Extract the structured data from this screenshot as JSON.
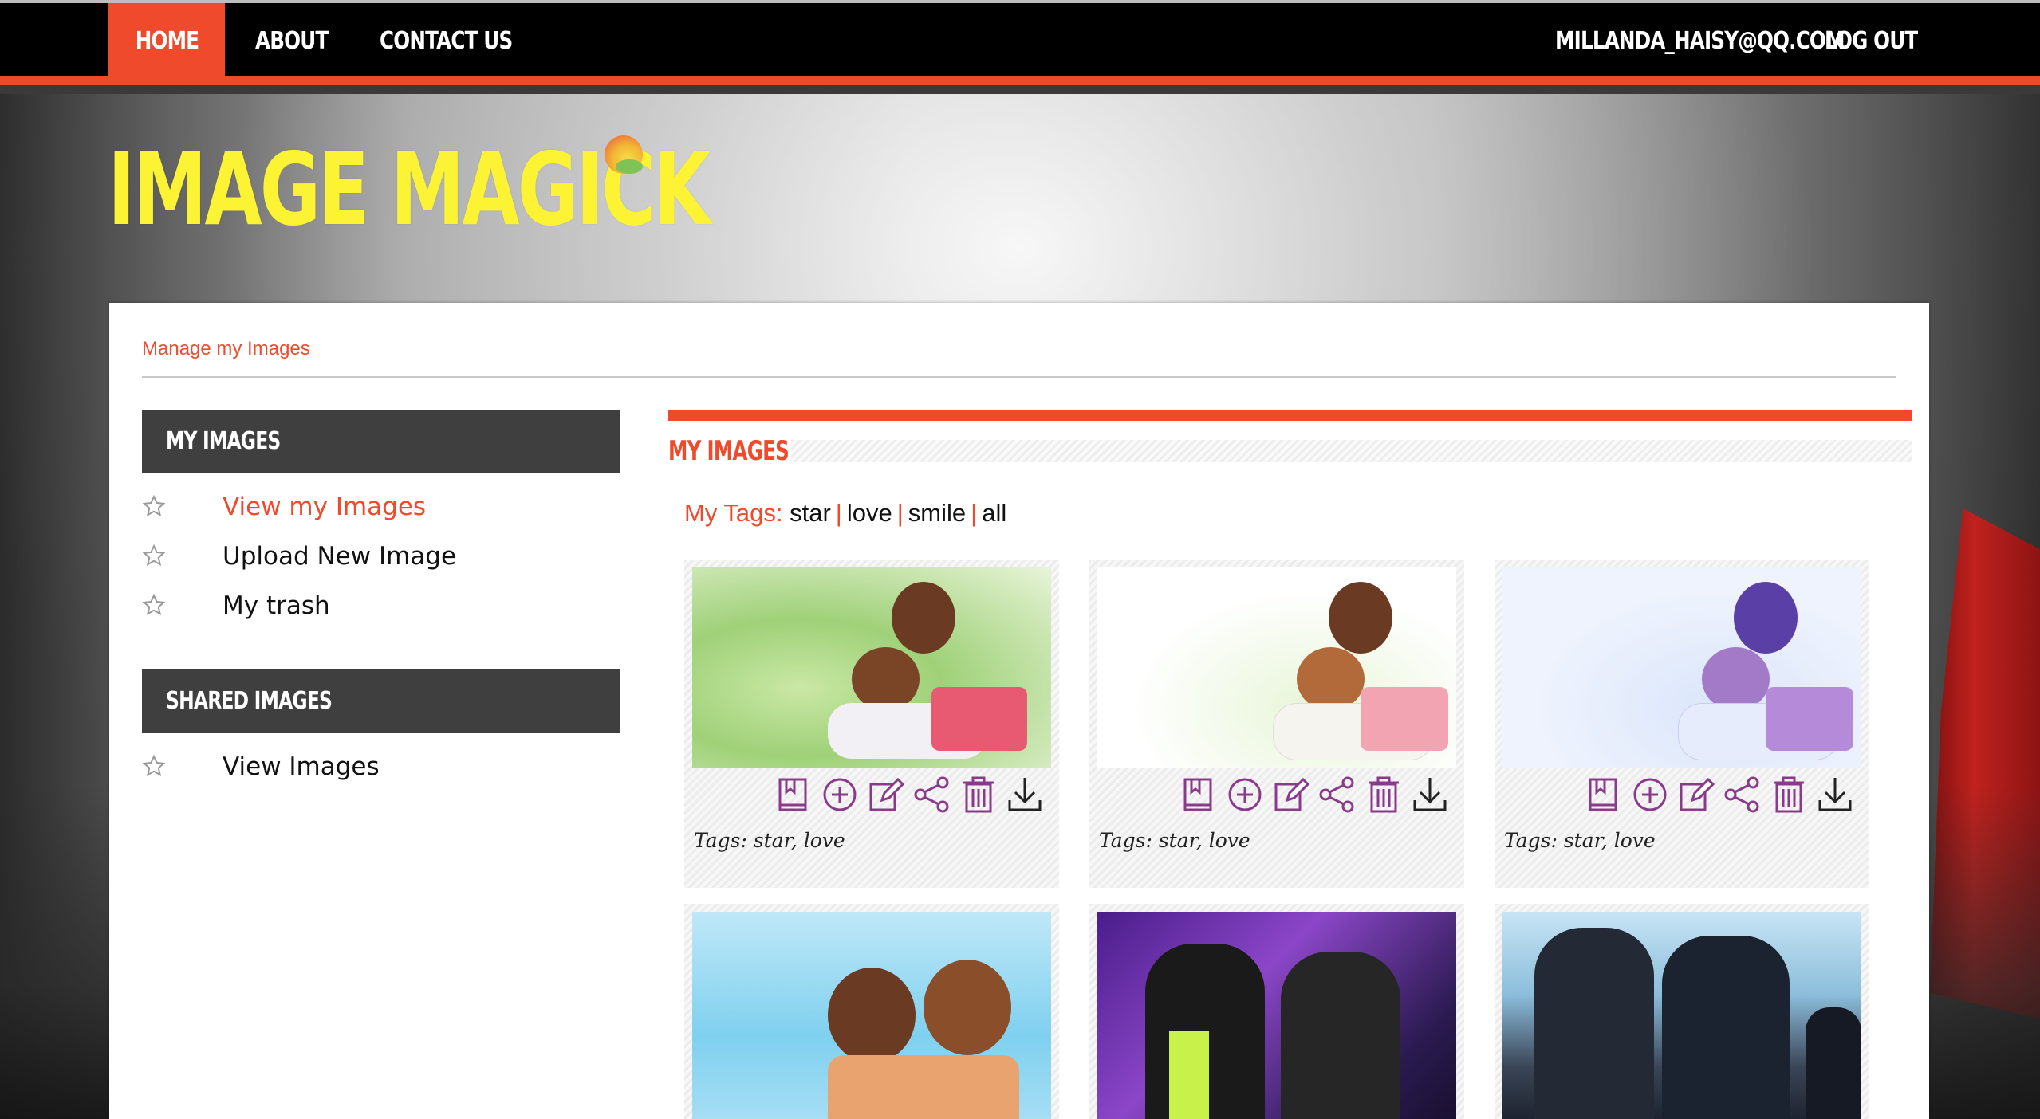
{
  "nav": {
    "items": [
      "HOME",
      "ABOUT",
      "CONTACT US"
    ],
    "user_email": "MILLANDA_HAISY@QQ.COM",
    "logout_label": "LOG OUT"
  },
  "brand": {
    "logo_text": "IMAGE MAGICK"
  },
  "breadcrumb": "Manage my Images",
  "sidebar": {
    "sections": [
      {
        "title": "MY IMAGES",
        "items": [
          "View my Images",
          "Upload New Image",
          "My trash"
        ]
      },
      {
        "title": "SHARED IMAGES",
        "items": [
          "View Images"
        ]
      }
    ]
  },
  "main": {
    "title": "MY IMAGES",
    "tags_label": "My Tags:",
    "tags": [
      "star",
      "love",
      "smile",
      "all"
    ],
    "card_tags_text": "Tags: star, love",
    "cards": [
      {
        "art": "green-chibi"
      },
      {
        "art": "white-chibi"
      },
      {
        "art": "blue-chibi"
      },
      {
        "art": "sky-chibi"
      },
      {
        "art": "stage-photo"
      },
      {
        "art": "event-photo"
      }
    ],
    "card_actions": [
      "book-icon",
      "plus-circle-icon",
      "edit-icon",
      "share-icon",
      "trash-icon",
      "download-icon"
    ]
  },
  "colors": {
    "accent": "#f04a2c",
    "logo": "#fbf334",
    "sidebar_header": "#3f3f3f",
    "icon": "#8a3a8a"
  }
}
